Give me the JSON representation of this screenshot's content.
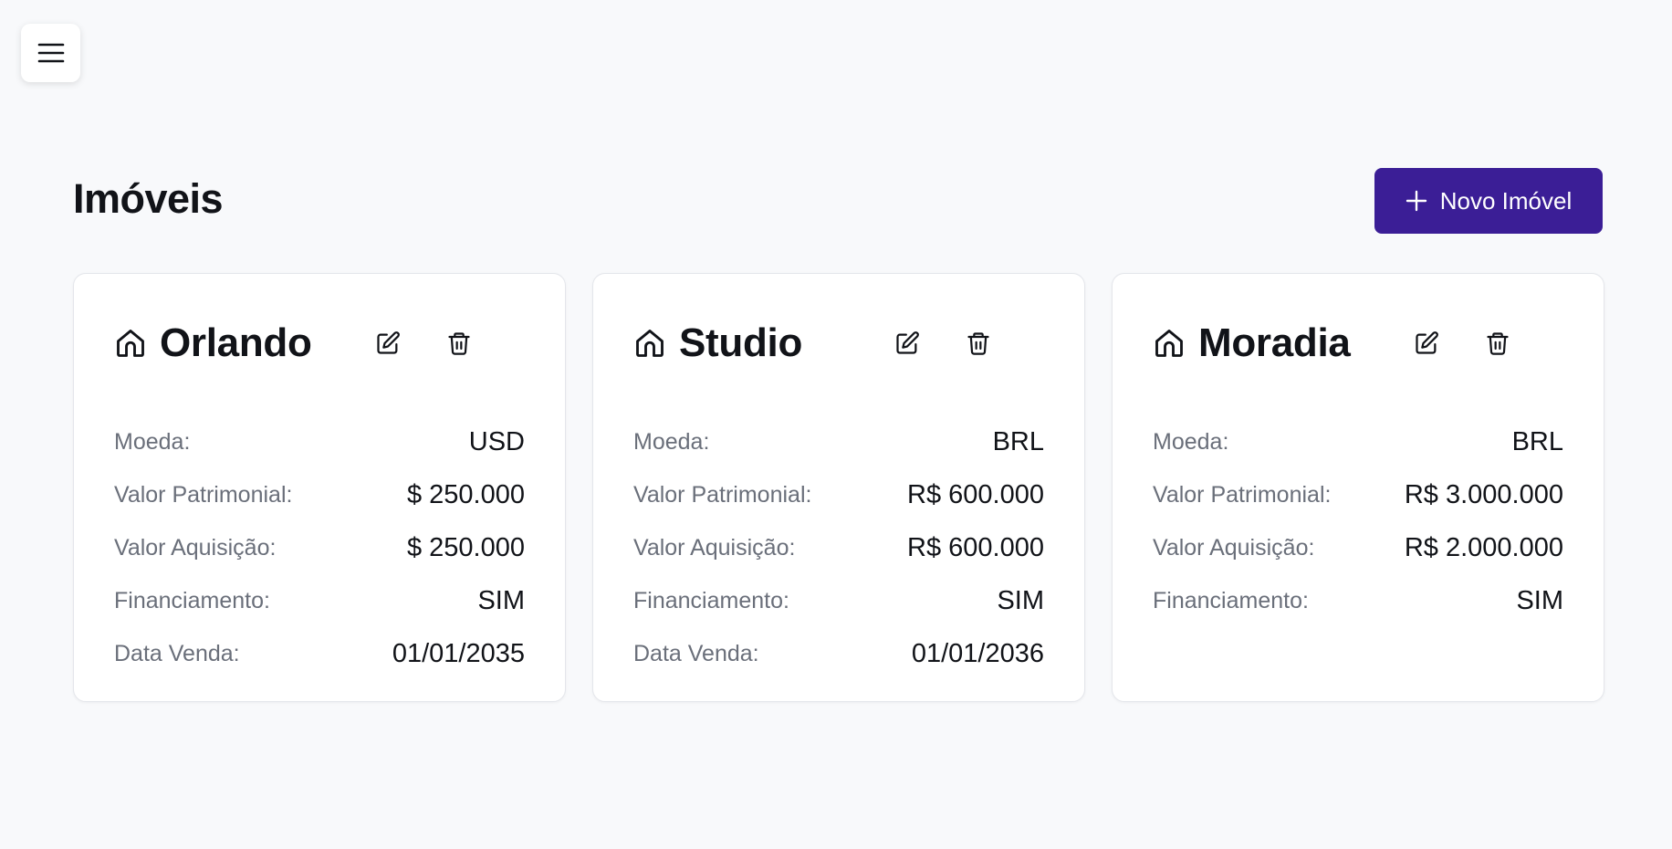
{
  "header": {
    "menu_icon": "hamburger-menu-icon",
    "title": "Imóveis",
    "new_button_label": "Novo Imóvel",
    "new_button_icon": "plus-icon",
    "accent_color": "#3b1e96"
  },
  "labels": {
    "moeda": "Moeda:",
    "valor_patrimonial": "Valor Patrimonial:",
    "valor_aquisicao": "Valor Aquisição:",
    "financiamento": "Financiamento:",
    "data_venda": "Data Venda:"
  },
  "cards": [
    {
      "name": "Orlando",
      "icon": "house-icon",
      "moeda": "USD",
      "valor_patrimonial": "$ 250.000",
      "valor_aquisicao": "$ 250.000",
      "financiamento": "SIM",
      "data_venda": "01/01/2035"
    },
    {
      "name": "Studio",
      "icon": "house-icon",
      "moeda": "BRL",
      "valor_patrimonial": "R$ 600.000",
      "valor_aquisicao": "R$ 600.000",
      "financiamento": "SIM",
      "data_venda": "01/01/2036"
    },
    {
      "name": "Moradia",
      "icon": "house-icon",
      "moeda": "BRL",
      "valor_patrimonial": "R$ 3.000.000",
      "valor_aquisicao": "R$ 2.000.000",
      "financiamento": "SIM"
    }
  ]
}
